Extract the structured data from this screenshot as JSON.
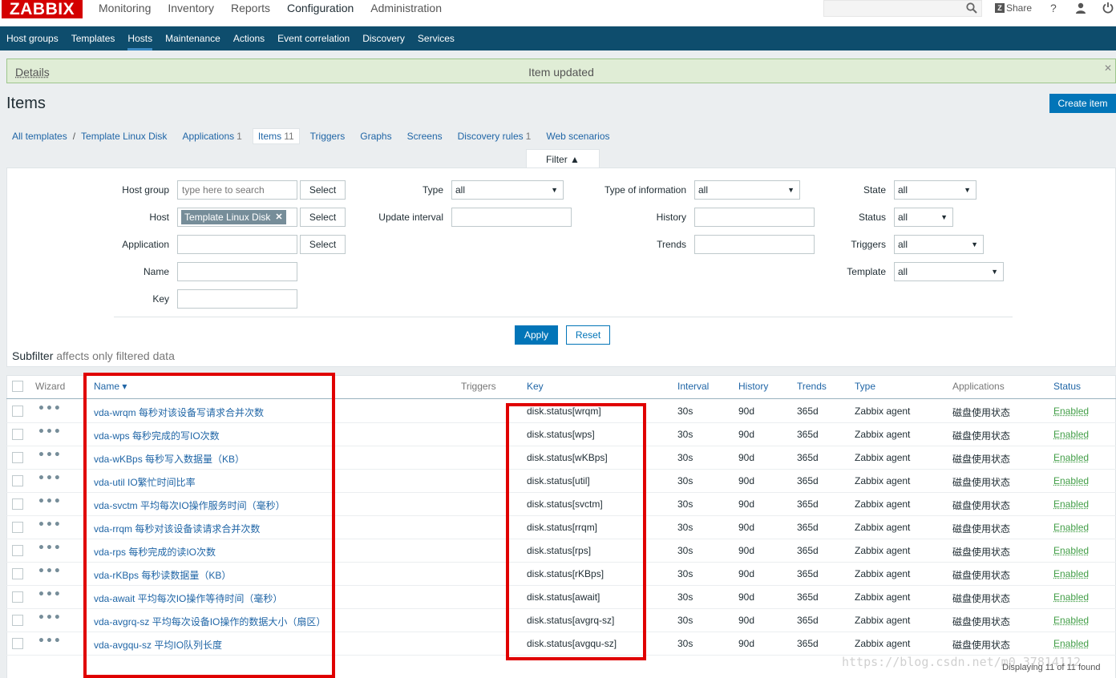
{
  "brand": {
    "logo": "ZABBIX"
  },
  "main_menu": [
    "Monitoring",
    "Inventory",
    "Reports",
    "Configuration",
    "Administration"
  ],
  "top_right": {
    "share_label": "Share",
    "help_label": "?"
  },
  "sub_menu": [
    "Host groups",
    "Templates",
    "Hosts",
    "Maintenance",
    "Actions",
    "Event correlation",
    "Discovery",
    "Services"
  ],
  "message": {
    "details": "Details",
    "text": "Item updated"
  },
  "page": {
    "title": "Items",
    "create_button": "Create item"
  },
  "breadcrumb": {
    "all_templates": "All templates",
    "separator": "/",
    "template": "Template Linux Disk"
  },
  "tabs": [
    {
      "label": "Applications",
      "count": "1"
    },
    {
      "label": "Items",
      "count": "11"
    },
    {
      "label": "Triggers",
      "count": ""
    },
    {
      "label": "Graphs",
      "count": ""
    },
    {
      "label": "Screens",
      "count": ""
    },
    {
      "label": "Discovery rules",
      "count": "1"
    },
    {
      "label": "Web scenarios",
      "count": ""
    }
  ],
  "filter": {
    "toggle_label": "Filter ▲",
    "host_group_label": "Host group",
    "host_group_placeholder": "type here to search",
    "host_label": "Host",
    "host_chip": "Template Linux Disk",
    "application_label": "Application",
    "name_label": "Name",
    "key_label": "Key",
    "select_label": "Select",
    "type_label": "Type",
    "type_value": "all",
    "update_interval_label": "Update interval",
    "type_of_info_label": "Type of information",
    "type_of_info_value": "all",
    "history_label": "History",
    "trends_label": "Trends",
    "state_label": "State",
    "state_value": "all",
    "status_label": "Status",
    "status_value": "all",
    "triggers_label": "Triggers",
    "triggers_value": "all",
    "template_label": "Template",
    "template_value": "all",
    "apply_label": "Apply",
    "reset_label": "Reset"
  },
  "subfilter": {
    "title": "Subfilter",
    "hint": "affects only filtered data"
  },
  "table": {
    "headers": {
      "wizard": "Wizard",
      "name": "Name ▾",
      "triggers": "Triggers",
      "key": "Key",
      "interval": "Interval",
      "history": "History",
      "trends": "Trends",
      "type": "Type",
      "applications": "Applications",
      "status": "Status"
    },
    "rows": [
      {
        "name": "vda-wrqm 每秒对该设备写请求合并次数",
        "key": "disk.status[wrqm]",
        "interval": "30s",
        "history": "90d",
        "trends": "365d",
        "type": "Zabbix agent",
        "application": "磁盘使用状态",
        "status": "Enabled"
      },
      {
        "name": "vda-wps 每秒完成的写IO次数",
        "key": "disk.status[wps]",
        "interval": "30s",
        "history": "90d",
        "trends": "365d",
        "type": "Zabbix agent",
        "application": "磁盘使用状态",
        "status": "Enabled"
      },
      {
        "name": "vda-wKBps 每秒写入数据量（KB）",
        "key": "disk.status[wKBps]",
        "interval": "30s",
        "history": "90d",
        "trends": "365d",
        "type": "Zabbix agent",
        "application": "磁盘使用状态",
        "status": "Enabled"
      },
      {
        "name": "vda-util IO繁忙时间比率",
        "key": "disk.status[util]",
        "interval": "30s",
        "history": "90d",
        "trends": "365d",
        "type": "Zabbix agent",
        "application": "磁盘使用状态",
        "status": "Enabled"
      },
      {
        "name": "vda-svctm 平均每次IO操作服务时间（毫秒）",
        "key": "disk.status[svctm]",
        "interval": "30s",
        "history": "90d",
        "trends": "365d",
        "type": "Zabbix agent",
        "application": "磁盘使用状态",
        "status": "Enabled"
      },
      {
        "name": "vda-rrqm 每秒对该设备读请求合并次数",
        "key": "disk.status[rrqm]",
        "interval": "30s",
        "history": "90d",
        "trends": "365d",
        "type": "Zabbix agent",
        "application": "磁盘使用状态",
        "status": "Enabled"
      },
      {
        "name": "vda-rps 每秒完成的读IO次数",
        "key": "disk.status[rps]",
        "interval": "30s",
        "history": "90d",
        "trends": "365d",
        "type": "Zabbix agent",
        "application": "磁盘使用状态",
        "status": "Enabled"
      },
      {
        "name": "vda-rKBps 每秒读数据量（KB）",
        "key": "disk.status[rKBps]",
        "interval": "30s",
        "history": "90d",
        "trends": "365d",
        "type": "Zabbix agent",
        "application": "磁盘使用状态",
        "status": "Enabled"
      },
      {
        "name": "vda-await 平均每次IO操作等待时间（毫秒）",
        "key": "disk.status[await]",
        "interval": "30s",
        "history": "90d",
        "trends": "365d",
        "type": "Zabbix agent",
        "application": "磁盘使用状态",
        "status": "Enabled"
      },
      {
        "name": "vda-avgrq-sz 平均每次设备IO操作的数据大小（扇区）",
        "key": "disk.status[avgrq-sz]",
        "interval": "30s",
        "history": "90d",
        "trends": "365d",
        "type": "Zabbix agent",
        "application": "磁盘使用状态",
        "status": "Enabled"
      },
      {
        "name": "vda-avgqu-sz 平均IO队列长度",
        "key": "disk.status[avgqu-sz]",
        "interval": "30s",
        "history": "90d",
        "trends": "365d",
        "type": "Zabbix agent",
        "application": "磁盘使用状态",
        "status": "Enabled"
      }
    ]
  },
  "footer": {
    "displaying": "Displaying 11 of 11 found",
    "watermark": "https://blog.csdn.net/m0_37814112"
  },
  "colors": {
    "brand_red": "#d40000",
    "nav_bg": "#0e4d6d",
    "primary_button": "#0275b8",
    "link": "#1f65a6",
    "enabled": "#429e47",
    "highlight_box": "#e00000"
  }
}
